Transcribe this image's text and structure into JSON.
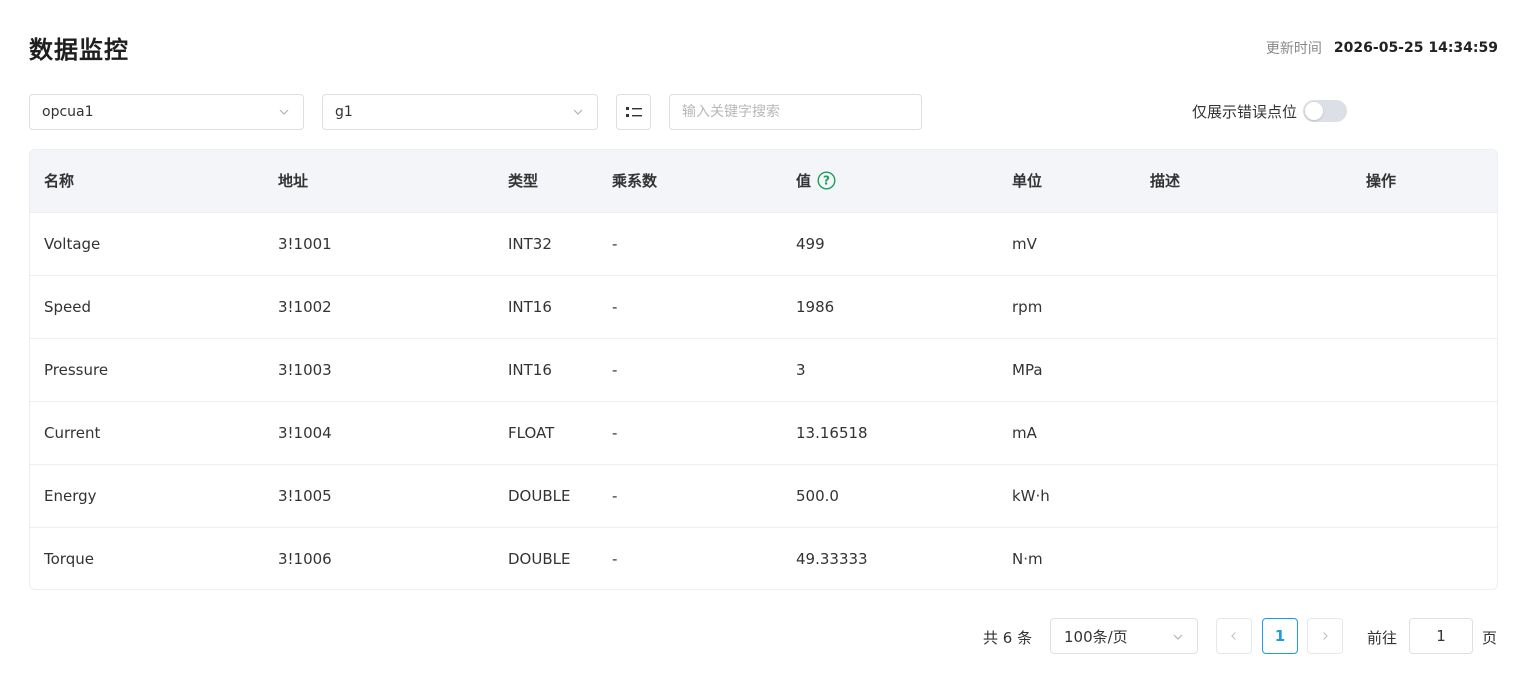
{
  "header": {
    "title": "数据监控",
    "update_label": "更新时间",
    "update_value": "2026-05-25 14:34:59"
  },
  "filters": {
    "device": "opcua1",
    "group": "g1",
    "search_placeholder": "输入关键字搜索",
    "error_only_label": "仅展示错误点位",
    "error_only_enabled": false
  },
  "table": {
    "columns": {
      "name": "名称",
      "address": "地址",
      "type": "类型",
      "multiplier": "乘系数",
      "value": "值",
      "unit": "单位",
      "description": "描述",
      "action": "操作"
    },
    "rows": [
      {
        "name": "Voltage",
        "address": "3!1001",
        "type": "INT32",
        "multiplier": "-",
        "value": "499",
        "unit": "mV",
        "description": ""
      },
      {
        "name": "Speed",
        "address": "3!1002",
        "type": "INT16",
        "multiplier": "-",
        "value": "1986",
        "unit": "rpm",
        "description": ""
      },
      {
        "name": "Pressure",
        "address": "3!1003",
        "type": "INT16",
        "multiplier": "-",
        "value": "3",
        "unit": "MPa",
        "description": ""
      },
      {
        "name": "Current",
        "address": "3!1004",
        "type": "FLOAT",
        "multiplier": "-",
        "value": "13.16518",
        "unit": "mA",
        "description": ""
      },
      {
        "name": "Energy",
        "address": "3!1005",
        "type": "DOUBLE",
        "multiplier": "-",
        "value": "500.0",
        "unit": "kW·h",
        "description": ""
      },
      {
        "name": "Torque",
        "address": "3!1006",
        "type": "DOUBLE",
        "multiplier": "-",
        "value": "49.33333",
        "unit": "N·m",
        "description": ""
      }
    ]
  },
  "pagination": {
    "total_text": "共 6 条",
    "page_size": "100条/页",
    "current_page": "1",
    "goto_label": "前往",
    "goto_value": "1",
    "page_unit": "页"
  },
  "colors": {
    "accent": "#1e9be8",
    "help_icon": "#19a05b"
  }
}
